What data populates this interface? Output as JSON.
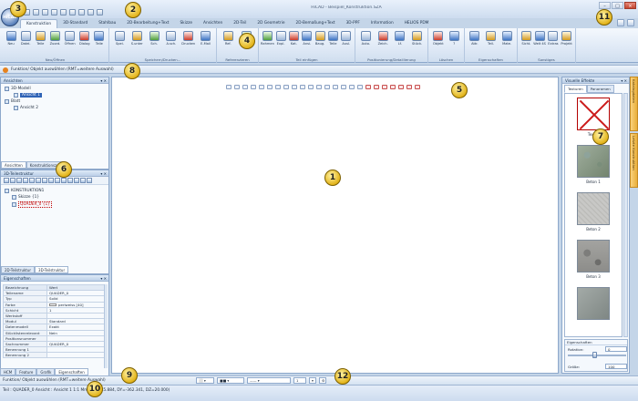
{
  "window": {
    "title": "HiCAD - Beispiel_Konstruktion.SZA"
  },
  "app_orb": {
    "label": "HiCAD"
  },
  "window_controls": {
    "minimize": "–",
    "maximize": "□",
    "close": "×"
  },
  "tabs": [
    "Konstruktion",
    "3D-Standard",
    "Stahlbau",
    "2D-Bearbeitung+Text",
    "Skizze",
    "Ansichten",
    "2D-Teil",
    "2D Geometrie",
    "2D-Bemaßung+Text",
    "3D-PPF",
    "Information",
    "HELIOS PDM"
  ],
  "ribbon": {
    "groups": [
      {
        "label": "Neu/Öffnen",
        "buttons": [
          "Neu",
          "Datei.",
          "Teile",
          "Zuord.",
          "Öffnen",
          "Dialog",
          "Teile"
        ]
      },
      {
        "label": "Speichern/Drucken...",
        "buttons": [
          "Spei.",
          "S.unter",
          "Sch.",
          "A.sch.",
          "Drucken",
          "E-Mail"
        ]
      },
      {
        "label": "Referenzieren",
        "buttons": [
          "Ref.",
          "Verknüp."
        ]
      },
      {
        "label": "Teil einfügen",
        "buttons": [
          "Rahmen",
          "Expl.",
          "Kat.",
          "Ansi.",
          "Baug.",
          "Teile",
          "Ausl."
        ]
      },
      {
        "label": "Positionierung/Detaillierung",
        "buttons": [
          "Auto.",
          "Zeich.",
          "Lf.",
          "Stück."
        ]
      },
      {
        "label": "Löschen",
        "buttons": [
          "Objekt",
          "?"
        ]
      },
      {
        "label": "Eigenschaften",
        "buttons": [
          "Attr.",
          "Teil.",
          "Mate."
        ]
      },
      {
        "label": "Sonstiges",
        "buttons": [
          "Sicht.",
          "Welt 4S",
          "Extras",
          "Projekt"
        ]
      }
    ]
  },
  "command_line": {
    "text": "Funktion/ Objekt auswählen (RMT=weitere Auswahl)"
  },
  "views_panel": {
    "title": "Ansichten",
    "controls": "▾ ✕",
    "tree": [
      "3D-Modell",
      "Ansicht 1",
      "Blatt",
      "Ansicht 2"
    ],
    "tabs": [
      "Ansichten",
      "Konstruktionsz..."
    ]
  },
  "structure_panel": {
    "title": "3D-Teilestruktur",
    "controls": "▾ ✕",
    "tree": [
      "KONSTRUKTION1",
      "Skizze {1}",
      "QUADER_0 {1}"
    ],
    "tabs": [
      "2D-Teilstruktur",
      "3D-Teilstruktur"
    ]
  },
  "properties_panel": {
    "title": "Eigenschaften",
    "controls": "▾ ✕",
    "headers": [
      "Bezeichnung",
      "Wert"
    ],
    "rows": [
      [
        "Teilename",
        "QUADER_0"
      ],
      [
        "Typ",
        "Solid"
      ],
      [
        "Farbe",
        "perlweiss [40]"
      ],
      [
        "Schicht",
        "1"
      ],
      [
        "Werkstoff",
        ""
      ],
      [
        "Modul",
        "Standard"
      ],
      [
        "Datenmodell",
        "Exakt"
      ],
      [
        "Stücklistenrelevant",
        "Nein"
      ],
      [
        "Positionsnummer",
        ""
      ],
      [
        "Sachnummer",
        "QUADER_0"
      ],
      [
        "Benennung 1",
        ""
      ],
      [
        "Benennung 2",
        ""
      ]
    ]
  },
  "bottom_tabs": [
    "HCM",
    "Feature",
    "Grafik",
    "Eigenschaften"
  ],
  "effects_panel": {
    "title": "Visuelle Effekte",
    "controls": "▾ ✕",
    "tabs": [
      "Texturen",
      "Panoramen"
    ],
    "items": [
      "Textur",
      "Beton 1",
      "Beton 2",
      "Beton 3",
      ""
    ],
    "props_title": "Eigenschaften",
    "rotation_label": "Rotation:",
    "rotation_value": "0",
    "size_label": "Größe:",
    "size_value": "100"
  },
  "side_tabs": [
    "Katalogdaten",
    "Letzte Konstruktion"
  ],
  "status": {
    "line1": "Funktion/ Objekt auswählen (RMT=weitere Auswahl)",
    "line2": "Teil : QUADER_0   Ansicht : Ansicht 1 1:1  Mm  ( DX=45.884, DY=-362.341, DZ=20.000)",
    "layer_value": "1"
  },
  "callouts": [
    "1",
    "2",
    "3",
    "4",
    "5",
    "6",
    "7",
    "8",
    "9",
    "10",
    "11",
    "12"
  ]
}
